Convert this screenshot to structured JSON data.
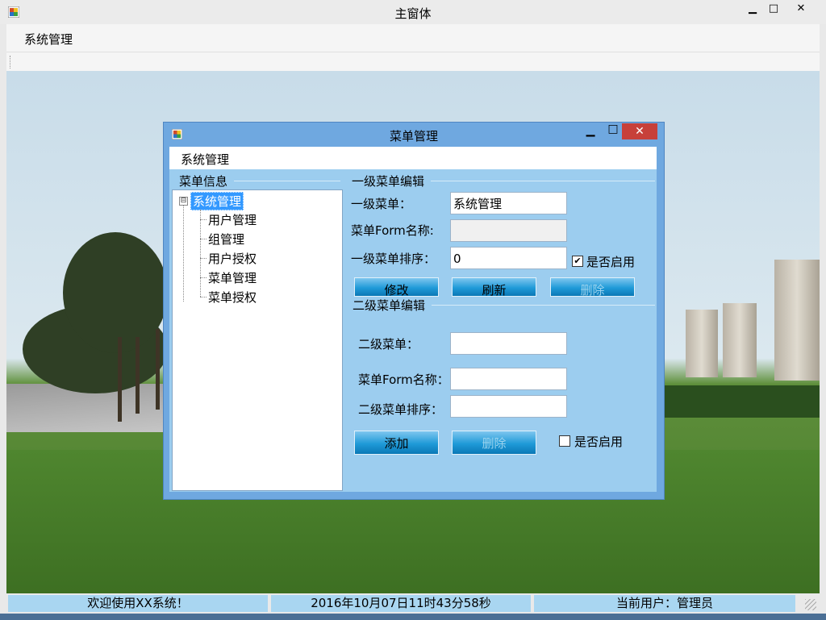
{
  "window": {
    "title": "主窗体",
    "minimize": "▁",
    "maximize": "□",
    "close": "✕"
  },
  "menubar": {
    "items": [
      "系统管理"
    ]
  },
  "dialog": {
    "title": "菜单管理",
    "minimize": "▁",
    "maximize": "□",
    "close": "✕",
    "menubar": {
      "items": [
        "系统管理"
      ]
    },
    "tree": {
      "group_label": "菜单信息",
      "toggle": "⊟",
      "root": "系统管理",
      "children": [
        "用户管理",
        "组管理",
        "用户授权",
        "菜单管理",
        "菜单授权"
      ]
    },
    "level1": {
      "group_label": "一级菜单编辑",
      "menu_label": "一级菜单：",
      "menu_value": "系统管理",
      "form_label": "菜单Form名称:",
      "form_value": "",
      "order_label": "一级菜单排序：",
      "order_value": "0",
      "enabled_label": "是否启用",
      "enabled_checked": true,
      "buttons": {
        "edit": "修改",
        "refresh": "刷新",
        "delete": "删除"
      }
    },
    "level2": {
      "group_label": "二级菜单编辑",
      "menu_label": "二级菜单：",
      "menu_value": "",
      "form_label": "菜单Form名称：",
      "form_value": "",
      "order_label": "二级菜单排序：",
      "order_value": "",
      "enabled_label": "是否启用",
      "enabled_checked": false,
      "buttons": {
        "add": "添加",
        "delete": "删除"
      }
    }
  },
  "statusbar": {
    "welcome": "欢迎使用XX系统！",
    "datetime": "2016年10月07日11时43分58秒",
    "user": "当前用户：管理员"
  },
  "colors": {
    "dialog_frame": "#6fa8e0",
    "dialog_client": "#9ccdef",
    "close_button": "#c7403a",
    "tree_selection": "#3399ff",
    "status_cell": "#a9d6f1"
  }
}
